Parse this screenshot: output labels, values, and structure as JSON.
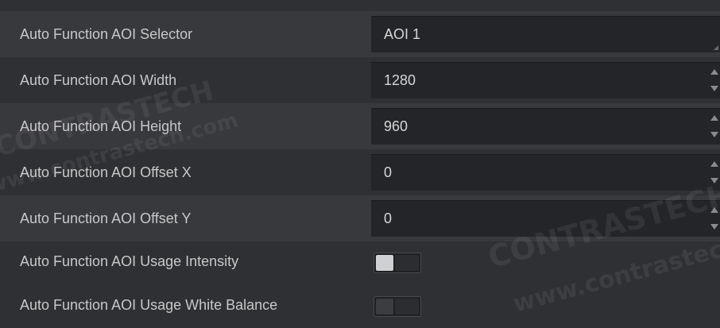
{
  "rows": [
    {
      "label": "Auto Function AOI Selector",
      "value": "AOI 1",
      "control": "combo"
    },
    {
      "label": "Auto Function AOI Width",
      "value": "1280",
      "control": "spin"
    },
    {
      "label": "Auto Function AOI Height",
      "value": "960",
      "control": "spin"
    },
    {
      "label": "Auto Function AOI Offset X",
      "value": "0",
      "control": "spin"
    },
    {
      "label": "Auto Function AOI Offset Y",
      "value": "0",
      "control": "spin"
    },
    {
      "label": "Auto Function AOI Usage Intensity",
      "control": "toggle",
      "state": "on"
    },
    {
      "label": "Auto Function AOI Usage White Balance",
      "control": "toggle",
      "state": "off"
    }
  ],
  "watermarks": {
    "left_brand": "CONTRASTECH",
    "left_url": "www.contrastech.com",
    "right_brand": "CONTRASTECH",
    "right_url": "www.contrastech.com"
  },
  "colors": {
    "background": "#2f3033",
    "field": "#242528",
    "label_text": "#c8c8c8"
  }
}
